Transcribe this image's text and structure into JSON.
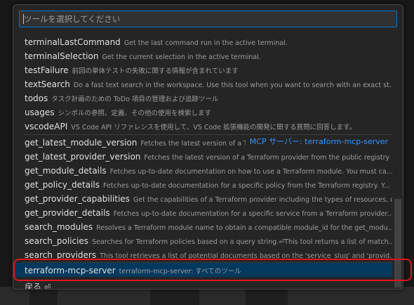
{
  "search": {
    "placeholder": "ツールを選択してください"
  },
  "group_label": "MCP サーバー: terraform-mcp-server",
  "items": [
    {
      "name": "terminalLastCommand",
      "desc": "Get the last command run in the active terminal."
    },
    {
      "name": "terminalSelection",
      "desc": "Get the current selection in the active terminal."
    },
    {
      "name": "testFailure",
      "desc": "前回の単体テストの失敗に関する情報が含まれています"
    },
    {
      "name": "textSearch",
      "desc": "Do a fast text search in the workspace. Use this tool when you want to search with an exact st..."
    },
    {
      "name": "todos",
      "desc": "タスク計画のための ToDo 項目の管理および追跡ツール"
    },
    {
      "name": "usages",
      "desc": "シンボルの参照、定義、その他の使用を検索します"
    },
    {
      "name": "vscodeAPI",
      "desc": "VS Code API リファレンスを使用して、VS Code 拡張機能の開発に関する質問に回答します。"
    },
    {
      "name": "get_latest_module_version",
      "desc": "Fetches the latest version of a Terraf..."
    },
    {
      "name": "get_latest_provider_version",
      "desc": "Fetches the latest version of a Terraform provider from the public registry"
    },
    {
      "name": "get_module_details",
      "desc": "Fetches up-to-date documentation on how to use a Terraform module. You must ca..."
    },
    {
      "name": "get_policy_details",
      "desc": "Fetches up-to-date documentation for a specific policy from the Terraform registry. Y..."
    },
    {
      "name": "get_provider_capabilities",
      "desc": "Get the capabilities of a Terraform provider including the types of resources, d..."
    },
    {
      "name": "get_provider_details",
      "desc": "Fetches up-to-date documentation for a specific service from a Terraform provider...."
    },
    {
      "name": "search_modules",
      "desc": "Resolves a Terraform module name to obtain a compatible module_id for the get_modu..."
    },
    {
      "name": "search_policies",
      "desc": "Searches for Terraform policies based on a query string.⏎This tool returns a list of match..."
    },
    {
      "name": "search_providers",
      "desc": "This tool retrieves a list of potential documents based on the 'service_slug' and 'provid..."
    },
    {
      "name": "terraform-mcp-server",
      "desc": "terraform-mcp-server: すべてのツール"
    }
  ],
  "back": {
    "label": "戻る",
    "icon": "return-icon"
  },
  "colors": {
    "accent": "#0078d4",
    "link": "#3794ff",
    "highlight_box": "#e0141f"
  }
}
